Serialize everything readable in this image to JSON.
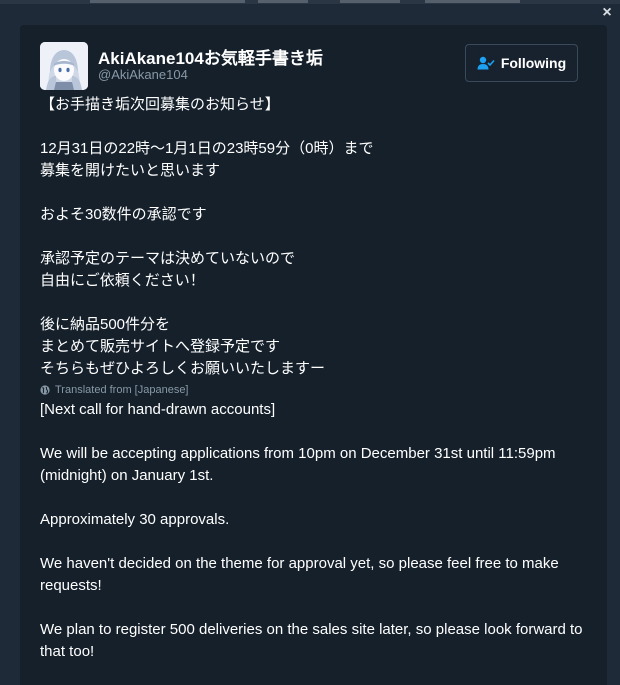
{
  "colors": {
    "background": "#1f2a38",
    "modal": "#15202b",
    "text_primary": "#ffffff",
    "text_secondary": "#8899a6",
    "button_border": "#3b4a5a",
    "accent_blue": "#1da1f2"
  },
  "window": {
    "close_glyph": "×",
    "close_icon": "close-icon"
  },
  "profile": {
    "display_name": "AkiAkane104お気軽手書き垢",
    "screen_name": "@AkiAkane104",
    "avatar_icon": "avatar"
  },
  "follow_button": {
    "label": "Following",
    "icon": "person-check-icon"
  },
  "tweet": {
    "lines": [
      "【お手描き垢次回募集のお知らせ】",
      "",
      "12月31日の22時～1月1日の23時59分（0時）まで",
      "募集を開けたいと思います",
      "",
      "およそ30数件の承認です",
      "",
      "承認予定のテーマは決めていないので",
      "自由にご依頼ください！",
      "",
      "後に納品500件分を",
      "まとめて販売サイトへ登録予定です",
      "そちらもぜひよろしくお願いいたしますー"
    ]
  },
  "translation": {
    "label": "Translated from [Japanese]",
    "icon": "globe-icon",
    "lines": [
      "[Next call for hand-drawn accounts]",
      "",
      "We will be accepting applications from 10pm on December 31st until 11:59pm (midnight) on January 1st.",
      "",
      "Approximately 30 approvals.",
      "",
      "We haven't decided on the theme for approval yet, so please feel free to make requests!",
      "",
      "We plan to register 500 deliveries on the sales site later, so please look forward to that too!"
    ]
  }
}
